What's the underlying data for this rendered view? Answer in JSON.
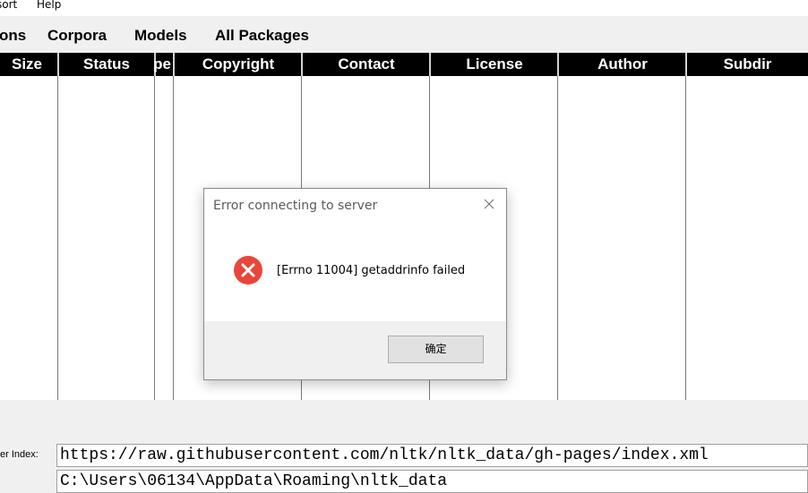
{
  "menubar": {
    "items": [
      "sort",
      "Help"
    ]
  },
  "tabs": [
    "ons",
    "Corpora",
    "Models",
    "All Packages"
  ],
  "table": {
    "columns": [
      "Size",
      "Status",
      "pe",
      "Copyright",
      "Contact",
      "License",
      "Author",
      "Subdir"
    ],
    "rows": []
  },
  "fields": {
    "server_index_label": "er Index:",
    "server_index_value": "https://raw.githubusercontent.com/nltk/nltk_data/gh-pages/index.xml",
    "dir_label": "",
    "dir_value": "C:\\Users\\06134\\AppData\\Roaming\\nltk_data"
  },
  "dialog": {
    "title": "Error connecting to server",
    "message": "[Errno 11004] getaddrinfo failed",
    "ok_label": "确定",
    "icon": "error-icon"
  },
  "colors": {
    "header_bg": "#000000",
    "header_text": "#ffffff",
    "error_red": "#e8463a",
    "window_bg": "#f0f0f0"
  }
}
